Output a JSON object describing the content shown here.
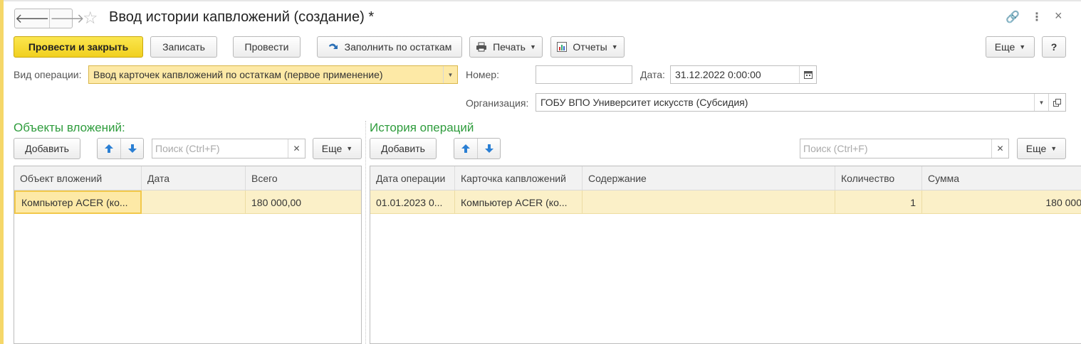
{
  "window": {
    "title": "Ввод истории капвложений (создание) *",
    "back_glyph": "🡐",
    "forward_glyph": "🡒",
    "star_glyph": "☆",
    "link_glyph": "🔗",
    "more_glyph": "⋮",
    "close_glyph": "×"
  },
  "toolbar": {
    "post_close": "Провести и закрыть",
    "save": "Записать",
    "post": "Провести",
    "fill": "Заполнить по остаткам",
    "print": "Печать",
    "reports": "Отчеты",
    "more": "Еще",
    "help": "?"
  },
  "form": {
    "operation_label": "Вид операции:",
    "operation_value": "Ввод карточек капвложений по остаткам (первое применение)",
    "number_label": "Номер:",
    "number_value": "",
    "date_label": "Дата:",
    "date_value": "31.12.2022  0:00:00",
    "org_label": "Организация:",
    "org_value": "ГОБУ ВПО Университет искусств (Субсидия)"
  },
  "objects": {
    "title": "Объекты вложений:",
    "add": "Добавить",
    "search_placeholder": "Поиск (Ctrl+F)",
    "more": "Еще",
    "columns": [
      "Объект вложений",
      "Дата",
      "Всего"
    ],
    "rows": [
      {
        "object": "Компьютер ACER (ко...",
        "date": "",
        "total": "180 000,00"
      }
    ]
  },
  "history": {
    "title": "История операций",
    "add": "Добавить",
    "search_placeholder": "Поиск (Ctrl+F)",
    "more": "Еще",
    "columns": [
      "Дата операции",
      "Карточка капвложений",
      "Содержание",
      "Количество",
      "Сумма"
    ],
    "rows": [
      {
        "date": "01.01.2023 0...",
        "card": "Компьютер ACER (ко...",
        "content": "",
        "qty": "1",
        "sum": "180 000"
      }
    ]
  },
  "colors": {
    "accent_yellow": "#f1d020",
    "section_green": "#2e9c3c",
    "selected_row": "#fbf0c8"
  }
}
